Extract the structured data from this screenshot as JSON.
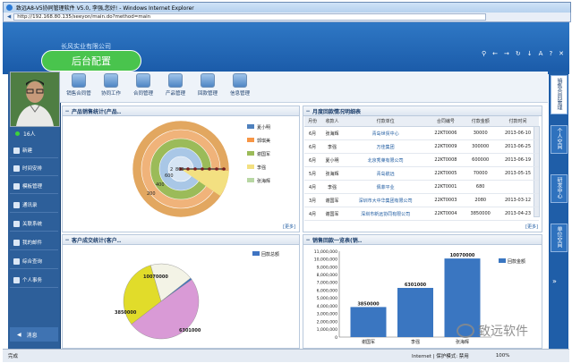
{
  "browser": {
    "title": "致远A8-V5协同管理软件 V5.0, 李强,您好! - Windows Internet Explorer",
    "address": "http://192.168.80.135/seeyon/main.do?method=main",
    "status_left": "完成",
    "status_zone": "Internet | 保护模式: 禁用",
    "zoom": "100%"
  },
  "header": {
    "title": "长风实业有限公司",
    "banner": "后台配置"
  },
  "sidebar": {
    "online_count": "16人",
    "items": [
      {
        "label": "新建"
      },
      {
        "label": "时间安排"
      },
      {
        "label": "模板管理"
      },
      {
        "label": "通讯录"
      },
      {
        "label": "关联系统"
      },
      {
        "label": "我的邮件"
      },
      {
        "label": "综合查询"
      },
      {
        "label": "个人事务"
      }
    ],
    "message": "消息"
  },
  "toolbar": {
    "items": [
      {
        "label": "销售合同管"
      },
      {
        "label": "协同工作"
      },
      {
        "label": "合同管理"
      },
      {
        "label": "产品管理"
      },
      {
        "label": "回款管理"
      },
      {
        "label": "信息管理"
      }
    ]
  },
  "right_rail": {
    "tabs": [
      "销售合同管理",
      "个人空间",
      "研发中心",
      "单位空间"
    ]
  },
  "panel_product": {
    "title": "产品销售统计(产品..",
    "more": "[更多]"
  },
  "panel_customer": {
    "title": "客户成交统计(客户.."
  },
  "panel_monthly": {
    "title": "月度回款情况明细表",
    "more": "[更多]",
    "columns": [
      "月份",
      "收款人",
      "付款单位",
      "合同编号",
      "付款金额",
      "付款时间"
    ],
    "rows": [
      [
        "6月",
        "张海辉",
        "青岛世贸中心",
        "22KT0006",
        "30000",
        "2013-06-10"
      ],
      [
        "6月",
        "李强",
        "万佳集团",
        "22KT0009",
        "300000",
        "2013-06-25"
      ],
      [
        "6月",
        "夏小明",
        "北京秀莱有限公司",
        "22KT0008",
        "600000",
        "2013-06-19"
      ],
      [
        "5月",
        "张海辉",
        "青岛航远",
        "22KT0005",
        "70000",
        "2013-05-15"
      ],
      [
        "4月",
        "李强",
        "佩菲平业",
        "22KT0001",
        "680",
        ""
      ],
      [
        "3月",
        "谢国军",
        "深圳市大中华集团有限公司",
        "22KT0003",
        "2080",
        "2013-03-12"
      ],
      [
        "4月",
        "谢国军",
        "深圳市新远协同有限公司",
        "22KT0004",
        "3850000",
        "2013-04-23"
      ]
    ]
  },
  "panel_sales": {
    "title": "销售回款一览表(销.."
  },
  "watermark": "致远软件",
  "chart_data": [
    {
      "type": "pie",
      "chart": "product-donut",
      "center_labels": [
        "2",
        "800"
      ],
      "ring_labels": [
        "600",
        "400",
        "200"
      ],
      "series": [
        {
          "name": "夏小明",
          "color": "#4f81bd"
        },
        {
          "name": "郭琪美",
          "color": "#f79646"
        },
        {
          "name": "谢国军",
          "color": "#9bbb59"
        },
        {
          "name": "李强",
          "color": "#f3e081"
        },
        {
          "name": "张海辉",
          "color": "#b8d7a3"
        }
      ]
    },
    {
      "type": "pie",
      "chart": "customer-pie",
      "legend": "回款总额",
      "slices": [
        {
          "label": "10070000",
          "value": 10070000,
          "color": "#d99ad6"
        },
        {
          "label": "6301000",
          "value": 6301000,
          "color": "#e1dc2a"
        },
        {
          "label": "3850000",
          "value": 3850000,
          "color": "#f3f3e6"
        },
        {
          "label": "",
          "value": 150000,
          "color": "#3f74c2"
        }
      ]
    },
    {
      "type": "bar",
      "chart": "sales-bar",
      "categories": [
        "谢国军",
        "李强",
        "张海辉"
      ],
      "series": [
        {
          "name": "回款金额",
          "values": [
            3850000,
            6301000,
            10070000
          ]
        }
      ],
      "value_labels": [
        "3850000",
        "6301000",
        "10070000"
      ],
      "yticks": [
        "11,000,000",
        "10,000,000",
        "9,000,000",
        "8,000,000",
        "7,000,000",
        "6,000,000",
        "5,000,000",
        "4,000,000",
        "3,000,000",
        "2,000,000",
        "1,000,000",
        "0"
      ],
      "ylim": [
        0,
        11000000
      ],
      "grid": false,
      "legend": "right"
    }
  ]
}
